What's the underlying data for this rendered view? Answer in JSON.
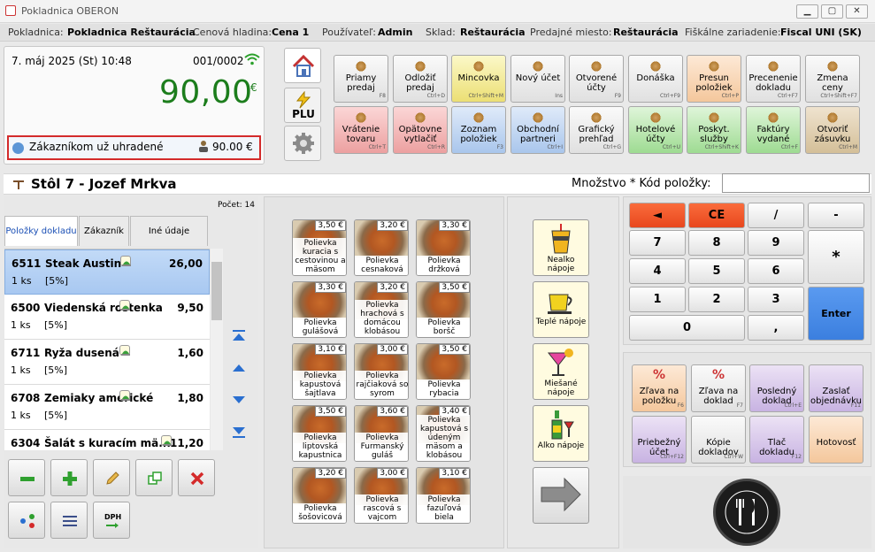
{
  "window": {
    "title": "Pokladnica OBERON",
    "min": "▁",
    "max": "▢",
    "close": "✕"
  },
  "info": {
    "pokladnica_label": "Pokladnica:",
    "pokladnica": "Pokladnica Reštaurácia",
    "hladina_label": "Cenová hladina:",
    "hladina": "Cena 1",
    "user_label": "Používateľ:",
    "user": "Admin",
    "sklad_label": "Sklad:",
    "sklad": "Reštaurácia",
    "miesto_label": "Predajné miesto:",
    "miesto": "Reštaurácia",
    "fisk_label": "Fiškálne zariadenie:",
    "fisk": "Fiscal UNI (SK)"
  },
  "total": {
    "datetime": "7. máj 2025 (St)  10:48",
    "doc_no": "001/0002",
    "amount": "90,00",
    "currency": "€",
    "paid_label": "Zákazníkom už uhradené",
    "paid_value": "90.00 €"
  },
  "functions": [
    {
      "label": "Priamy predaj",
      "shortcut": "F8",
      "color": "c-lt",
      "icon": "hand-icon"
    },
    {
      "label": "Odložiť predaj",
      "shortcut": "Ctrl+D",
      "color": "c-lt",
      "icon": "defer-icon"
    },
    {
      "label": "Mincovka",
      "shortcut": "Ctrl+Shift+M",
      "color": "c-yel",
      "icon": "coins-icon"
    },
    {
      "label": "Nový účet",
      "shortcut": "Ins",
      "color": "c-lt",
      "icon": "new-account-icon"
    },
    {
      "label": "Otvorené účty",
      "shortcut": "F9",
      "color": "c-lt",
      "icon": "open-accounts-icon"
    },
    {
      "label": "Donáška",
      "shortcut": "Ctrl+F9",
      "color": "c-lt",
      "icon": "car-icon"
    },
    {
      "label": "Presun položiek",
      "shortcut": "Ctrl+P",
      "color": "c-peach",
      "icon": "move-icon"
    },
    {
      "label": "Precenenie dokladu",
      "shortcut": "Ctrl+F7",
      "color": "c-lt",
      "icon": "reprice-icon"
    },
    {
      "label": "Zmena ceny",
      "shortcut": "Ctrl+Shift+F7",
      "color": "c-lt",
      "icon": "price-change-icon"
    },
    {
      "label": "Vrátenie tovaru",
      "shortcut": "Ctrl+T",
      "color": "c-red",
      "icon": "return-icon"
    },
    {
      "label": "Opätovne vytlačiť",
      "shortcut": "Ctrl+R",
      "color": "c-red",
      "icon": "reprint-icon"
    },
    {
      "label": "Zoznam položiek",
      "shortcut": "F3",
      "color": "c-blue",
      "icon": "item-list-icon"
    },
    {
      "label": "Obchodní partneri",
      "shortcut": "Ctrl+I",
      "color": "c-blue",
      "icon": "partners-icon"
    },
    {
      "label": "Grafický prehľad",
      "shortcut": "Ctrl+G",
      "color": "c-lt",
      "icon": "graph-icon"
    },
    {
      "label": "Hotelové účty",
      "shortcut": "Ctrl+U",
      "color": "c-green",
      "icon": "hotel-icon"
    },
    {
      "label": "Poskyt. služby",
      "shortcut": "Ctrl+Shift+K",
      "color": "c-green",
      "icon": "services-icon"
    },
    {
      "label": "Faktúry vydané",
      "shortcut": "Ctrl+F",
      "color": "c-green",
      "icon": "invoice-icon"
    },
    {
      "label": "Otvoriť zásuvku",
      "shortcut": "Ctrl+M",
      "color": "c-tan",
      "icon": "drawer-icon"
    }
  ],
  "nav": {
    "home": "home-icon",
    "plu": "PLU",
    "settings": "gear-icon"
  },
  "table": {
    "title": "Stôl 7 - Jozef Mrkva",
    "qty_label": "Množstvo * Kód položky:",
    "count": "Počet: 14"
  },
  "tabs": [
    "Položky dokladu",
    "Zákazník",
    "Iné údaje dokladu"
  ],
  "items": [
    {
      "code": "6511",
      "name": "Steak Austin",
      "price": "26,00",
      "qty": "1  ks",
      "disc": "[5%]"
    },
    {
      "code": "6500",
      "name": "Viedenská roštenka",
      "price": "9,50",
      "qty": "1  ks",
      "disc": "[5%]"
    },
    {
      "code": "6711",
      "name": "Ryža dusená",
      "price": "1,60",
      "qty": "1  ks",
      "disc": "[5%]"
    },
    {
      "code": "6708",
      "name": "Zemiaky americké",
      "price": "1,80",
      "qty": "1  ks",
      "disc": "[5%]"
    },
    {
      "code": "6304",
      "name": "Šalát s kuracím mä...",
      "price": "11,20",
      "qty": "1  ks",
      "disc": "[5%]"
    }
  ],
  "tiles": [
    {
      "price": "3,50 €",
      "name": "Polievka kuracia s cestovinou a mäsom"
    },
    {
      "price": "3,20 €",
      "name": "Polievka cesnaková"
    },
    {
      "price": "3,30 €",
      "name": "Polievka držková"
    },
    {
      "price": "3,30 €",
      "name": "Polievka gulášová"
    },
    {
      "price": "3,20 €",
      "name": "Polievka hrachová s domácou klobásou"
    },
    {
      "price": "3,50 €",
      "name": "Polievka boršč"
    },
    {
      "price": "3,10 €",
      "name": "Polievka kapustová šajtlava"
    },
    {
      "price": "3,00 €",
      "name": "Polievka rajčiaková so syrom"
    },
    {
      "price": "3,50 €",
      "name": "Polievka rybacia"
    },
    {
      "price": "3,50 €",
      "name": "Polievka liptovská kapustnica"
    },
    {
      "price": "3,60 €",
      "name": "Polievka Furmanský guláš"
    },
    {
      "price": "3,40 €",
      "name": "Polievka kapustová s údeným mäsom a klobásou"
    },
    {
      "price": "3,20 €",
      "name": "Polievka šošovicová"
    },
    {
      "price": "3,00 €",
      "name": "Polievka rascová s vajcom"
    },
    {
      "price": "3,10 €",
      "name": "Polievka fazuľová biela"
    }
  ],
  "categories": [
    {
      "label": "Nealko nápoje",
      "icon": "soda-cup-icon"
    },
    {
      "label": "Teplé nápoje",
      "icon": "coffee-cup-icon"
    },
    {
      "label": "Miešané nápoje",
      "icon": "cocktail-icon"
    },
    {
      "label": "Alko nápoje",
      "icon": "wine-bottle-icon"
    }
  ],
  "keys": {
    "back": "◄",
    "ce": "CE",
    "slash": "/",
    "minus": "-",
    "k7": "7",
    "k8": "8",
    "k9": "9",
    "star": "*",
    "k4": "4",
    "k5": "5",
    "k6": "6",
    "k1": "1",
    "k2": "2",
    "k3": "3",
    "enter": "Enter",
    "k0": "0",
    "comma": ","
  },
  "actions": [
    {
      "label": "Zľava na položku",
      "shortcut": "F6",
      "color": "c-peach",
      "glyph": "%"
    },
    {
      "label": "Zľava na doklad",
      "shortcut": "F7",
      "color": "c-lt",
      "glyph": "%"
    },
    {
      "label": "Posledný doklad",
      "shortcut": "Ctrl+E",
      "color": "c-purp",
      "glyph": ""
    },
    {
      "label": "Zaslať objednávku",
      "shortcut": "F11",
      "color": "c-purp",
      "glyph": ""
    },
    {
      "label": "Priebežný účet",
      "shortcut": "Ctrl+F12",
      "color": "c-purp",
      "glyph": ""
    },
    {
      "label": "Kópie dokladov",
      "shortcut": "Ctrl+W",
      "color": "c-lt",
      "glyph": ""
    },
    {
      "label": "Tlač dokladu",
      "shortcut": "F12",
      "color": "c-purp",
      "glyph": ""
    },
    {
      "label": "Hotovosť",
      "shortcut": "",
      "color": "c-peach",
      "glyph": ""
    }
  ],
  "logo": {
    "top": "RESTAURANT",
    "bottom": "FOOD & DRINK"
  },
  "colors": {
    "accent_green": "#1c7d1c",
    "highlight_red": "#d32b2b",
    "enter_blue": "#3b7fdf",
    "ce_red": "#e8471d"
  }
}
